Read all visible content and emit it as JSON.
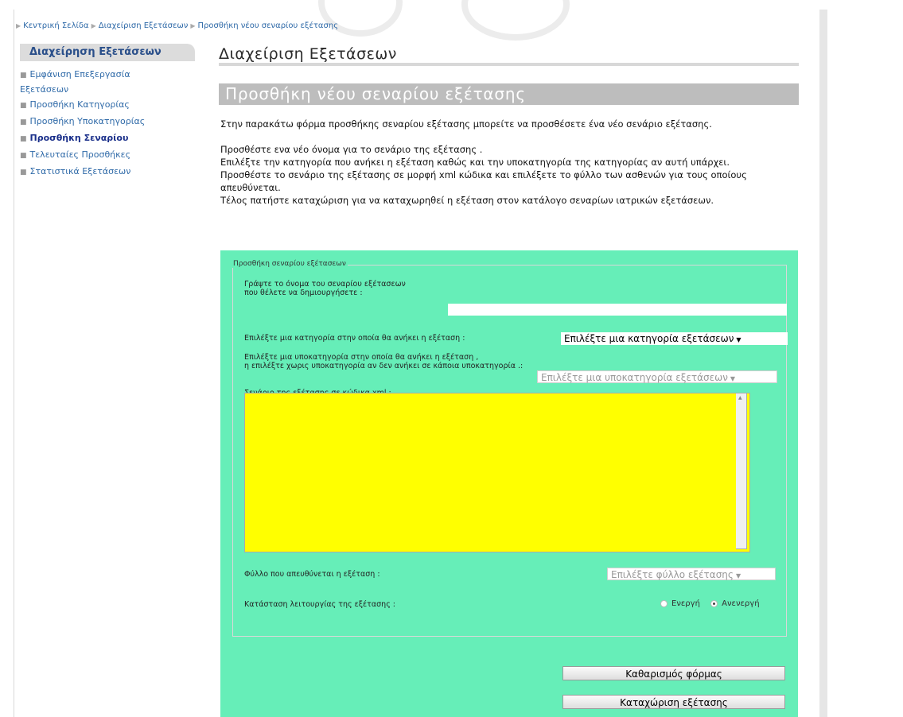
{
  "breadcrumb": {
    "items": [
      "Κεντρική Σελίδα",
      "Διαχείριση Εξετάσεων",
      "Προσθήκη νέου σεναρίου εξέτασης"
    ]
  },
  "sidebar": {
    "title": "Διαχείρηση Εξετάσεων",
    "items": [
      {
        "label": "Εμφάνιση Επεξεργασία",
        "label2": "Εξετάσεων"
      },
      {
        "label": "Προσθήκη Κατηγορίας"
      },
      {
        "label": "Προσθήκη Υποκατηγορίας"
      },
      {
        "label": "Προσθήκη Σεναρίου",
        "active": true
      },
      {
        "label": "Τελευταίες Προσθήκες"
      },
      {
        "label": "Στατιστικά Εξετάσεων"
      }
    ]
  },
  "main": {
    "title": "Διαχείριση Εξετάσεων",
    "section_title": "Προσθήκη νέου σεναρίου εξέτασης",
    "intro": {
      "p1": "Στην παρακάτω φόρμα προσθήκης σεναρίου εξέτασης μπορείτε να προσθέσετε ένα νέο σενάριο εξέτασης.",
      "p2_line1": "Προσθέστε ενα νέο όνομα για το σενάριο της εξέτασης .",
      "p2_line2": "Επιλέξτε την κατηγορία που ανήκει η εξέταση καθώς και την υποκατηγορία της κατηγορίας αν αυτή υπάρχει.",
      "p2_line3": "Προσθέστε το σενάριο της εξέτασης σε μορφή xml κώδικα και επιλέξετε το φύλλο των ασθενών για τους οποίους απευθύνεται.",
      "p2_line4": "Τέλος πατήστε καταχώριση για να καταχωρηθεί η εξέταση στον κατάλογο σεναρίων ιατρικών εξετάσεων."
    }
  },
  "form": {
    "legend": "Προσθήκη σεναρίου εξέτασεων",
    "name_label_line1": "Γράψτε το όνομα του σεναρίου εξέτασεων",
    "name_label_line2": "που θέλετε να δημιουργήσετε :",
    "name_value": "",
    "category_label": "Επιλέξτε μια κατηγορία στην οποία θα ανήκει η εξέταση :",
    "category_selected": "Επιλέξτε μια κατηγορία εξετάσεων",
    "subcategory_label_line1": "Επιλέξτε μια υποκατηγορία στην οποία θα ανήκει η εξέταση ,",
    "subcategory_label_line2": "η επιλέξτε χωρις υποκατηγορία αν δεν ανήκει σε κάποια υποκατηγορία .:",
    "subcategory_selected": "Επιλέξτε μια υποκατηγορία εξετάσεων",
    "xml_label": "Σενάριο της εξέτασης σε κώδικα xml :",
    "xml_value": "",
    "xml_bg": "#ffff00",
    "gender_label": "Φύλλο που απευθύνεται η εξέταση :",
    "gender_selected": "Επιλέξτε φύλλο εξέτασης",
    "status_label": "Κατάσταση λειτουργίας της εξέτασης :",
    "status_options": [
      "Ενεργή",
      "Ανενεργή"
    ],
    "status_selected": "Ανενεργή",
    "clear_button": "Καθαρισμός φόρμας",
    "submit_button": "Καταχώριση εξέτασης",
    "panel_bg": "#66eeb8"
  }
}
